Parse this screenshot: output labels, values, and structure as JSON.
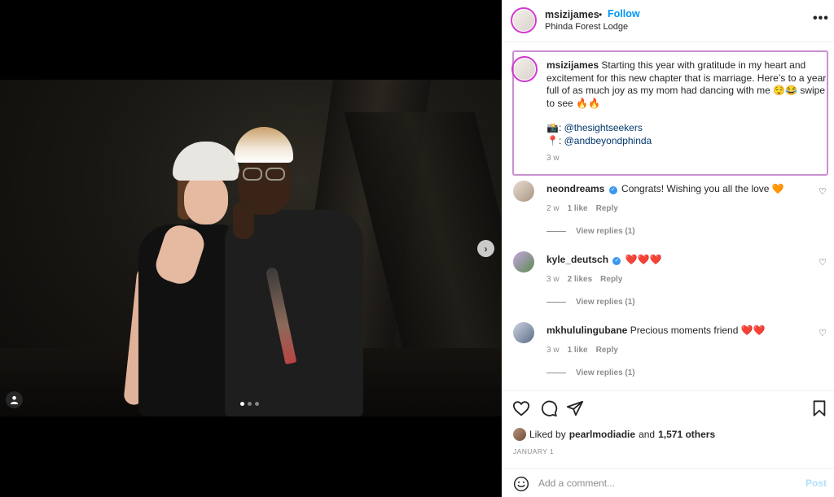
{
  "post": {
    "username": "msizijames",
    "bullet": "•",
    "follow_label": "Follow",
    "location": "Phinda Forest Lodge",
    "more_label": "•••"
  },
  "caption": {
    "username": "msizijames",
    "text": "Starting this year with gratitude in my heart and excitement for this new chapter that is marriage. Here’s to a year full of as much joy as my mom had dancing with me 😌😂 swipe to see 🔥🔥",
    "credit1_emoji": "📸:",
    "credit1_link": "@thesightseekers",
    "credit2_emoji": "📍:",
    "credit2_link": "@andbeyondphinda",
    "time": "3 w"
  },
  "comments": [
    {
      "username": "neondreams",
      "verified": true,
      "text": "Congrats! Wishing you all the love 🧡",
      "time": "2 w",
      "likes": "1 like",
      "reply_label": "Reply",
      "view_replies": "View replies (1)",
      "avatar_color": "#c9b8a4"
    },
    {
      "username": "kyle_deutsch",
      "verified": true,
      "text": "❤️❤️❤️",
      "time": "3 w",
      "likes": "2 likes",
      "reply_label": "Reply",
      "view_replies": "View replies (1)",
      "avatar_color": "#8f7fb8"
    },
    {
      "username": "mkhululingubane",
      "verified": false,
      "text": "Precious moments friend ❤️❤️",
      "time": "3 w",
      "likes": "1 like",
      "reply_label": "Reply",
      "view_replies": "View replies (1)",
      "avatar_color": "#7d8da6"
    }
  ],
  "icons": {
    "heart": "heart-icon",
    "comment": "comment-icon",
    "share": "share-icon",
    "save": "bookmark-icon",
    "emoji": "emoji-icon",
    "next": "chevron-right-icon",
    "tag": "user-tag-icon"
  },
  "likes": {
    "prefix": "Liked by",
    "user": "pearlmodiadie",
    "middle": "and",
    "others": "1,571 others"
  },
  "date": "JANUARY 1",
  "add_comment": {
    "placeholder": "Add a comment...",
    "post_label": "Post"
  },
  "carousel": {
    "total": 3,
    "active": 1,
    "next_glyph": "›"
  },
  "colors": {
    "accent": "#0095f6",
    "story_ring": "#d03ad0",
    "caption_highlight": "#c98fcf",
    "post_disabled": "#b2dffc"
  }
}
